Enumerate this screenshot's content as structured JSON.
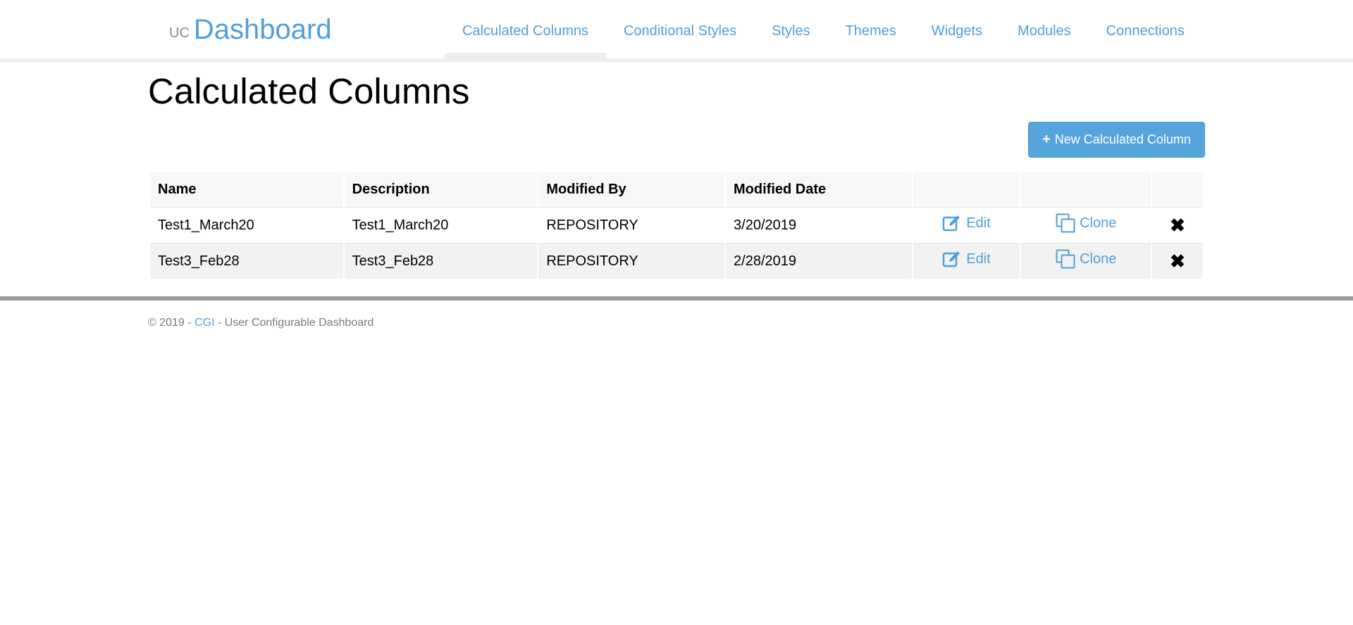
{
  "brand": {
    "prefix": "UC",
    "name": "Dashboard"
  },
  "nav": {
    "items": [
      {
        "label": "Calculated Columns",
        "active": true
      },
      {
        "label": "Conditional Styles"
      },
      {
        "label": "Styles"
      },
      {
        "label": "Themes"
      },
      {
        "label": "Widgets"
      },
      {
        "label": "Modules"
      },
      {
        "label": "Connections"
      }
    ]
  },
  "page": {
    "title": "Calculated Columns"
  },
  "toolbar": {
    "new_label": "New Calculated Column",
    "new_icon": "plus-icon"
  },
  "table": {
    "headers": [
      "Name",
      "Description",
      "Modified By",
      "Modified Date"
    ],
    "rows": [
      {
        "name": "Test1_March20",
        "description": "Test1_March20",
        "modified_by": "REPOSITORY",
        "modified_date": "3/20/2019",
        "edit_label": "Edit",
        "clone_label": "Clone",
        "delete_icon": "close-icon"
      },
      {
        "name": "Test3_Feb28",
        "description": "Test3_Feb28",
        "modified_by": "REPOSITORY",
        "modified_date": "2/28/2019",
        "edit_label": "Edit",
        "clone_label": "Clone",
        "delete_icon": "close-icon"
      }
    ]
  },
  "footer": {
    "prefix": "© 2019 - ",
    "company": "CGI",
    "suffix": " - User Configurable Dashboard"
  },
  "colors": {
    "accent": "#4f9fdb",
    "button": "#55a4dc"
  }
}
